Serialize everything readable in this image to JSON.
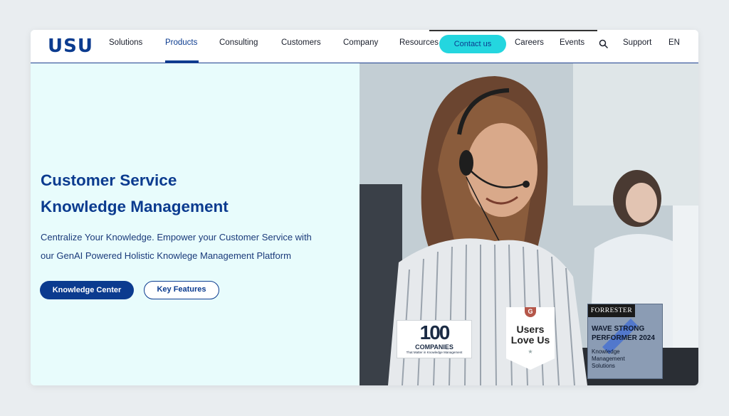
{
  "logo": "USU",
  "nav": {
    "items": [
      "Solutions",
      "Products",
      "Consulting",
      "Customers",
      "Company",
      "Resources"
    ],
    "active": "Products",
    "contact": "Contact us",
    "right_items": [
      "Careers",
      "Events"
    ],
    "support": "Support",
    "language": "EN"
  },
  "hero": {
    "title_line1": "Customer Service",
    "title_line2": "Knowledge Management",
    "subtitle_line1": "Centralize Your Knowledge. Empower your Customer Service with",
    "subtitle_line2": "our GenAI Powered Holistic Knowlege Management Platform",
    "primary_button": "Knowledge Center",
    "secondary_button": "Key Features"
  },
  "badges": {
    "companies": {
      "number": "100",
      "label": "COMPANIES",
      "tagline": "That Matter in Knowledge Management"
    },
    "g2": {
      "logo": "G",
      "text_line1": "Users",
      "text_line2": "Love Us",
      "star": "★"
    },
    "forrester": {
      "brand": "FORRESTER",
      "line1": "WAVE STRONG",
      "line2": "PERFORMER 2024",
      "cat_line1": "Knowledge",
      "cat_line2": "Management",
      "cat_line3": "Solutions"
    }
  },
  "colors": {
    "brand": "#0b3b8f",
    "accent": "#24d6df",
    "hero_bg": "#e8fcfc"
  }
}
